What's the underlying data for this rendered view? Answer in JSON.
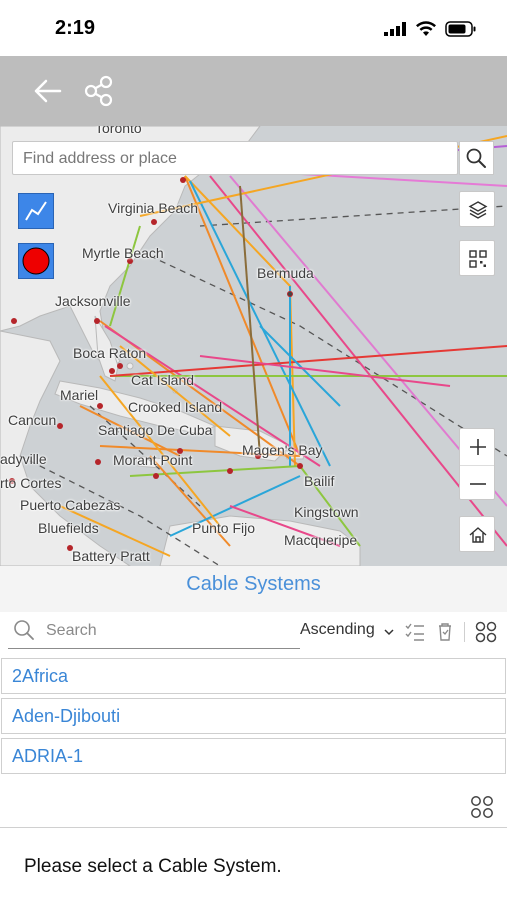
{
  "status_bar": {
    "time": "2:19",
    "icons": [
      "cellular-signal-icon",
      "wifi-icon",
      "battery-icon"
    ]
  },
  "toolbar": {
    "back_icon": "arrow-left-icon",
    "share_icon": "share-nodes-icon"
  },
  "map": {
    "search_placeholder": "Find address or place",
    "labels": {
      "toronto": "Toronto",
      "virginia_beach": "Virginia Beach",
      "myrtle_beach": "Myrtle Beach",
      "bermuda": "Bermuda",
      "jacksonville": "Jacksonville",
      "boca_raton": "Boca Raton",
      "cat_island": "Cat Island",
      "mariel": "Mariel",
      "crooked_island": "Crooked Island",
      "cancun": "Cancun",
      "santiago_de_cuba": "Santiago De Cuba",
      "magens_bay": "Magen's Bay",
      "ladyville": "adyville",
      "morant_point": "Morant Point",
      "bailif": "Bailif",
      "puerto_cortes": "rto Cortes",
      "puerto_cabezas": "Puerto Cabezas",
      "kingstown": "Kingstown",
      "bluefields": "Bluefields",
      "punto_fijo": "Punto Fijo",
      "macqueripe": "Macqueripe",
      "battery_pratt": "Battery Pratt"
    },
    "colors": {
      "line_tool": "#3d86e8",
      "point_tool_fill": "#ee0000"
    }
  },
  "panel": {
    "title": "Cable Systems",
    "search_placeholder": "Search",
    "sort_label": "Ascending",
    "items": [
      "2Africa",
      "Aden-Djibouti",
      "ADRIA-1"
    ],
    "footer": "Please select a Cable System."
  }
}
